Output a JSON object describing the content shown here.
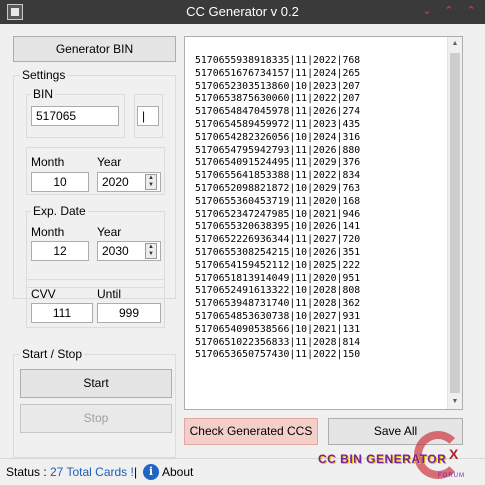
{
  "window": {
    "title": "CC Generator v 0.2",
    "controls": [
      "⌄",
      "⌃",
      "⌃"
    ]
  },
  "left": {
    "generator_bin_label": "Generator BIN",
    "settings": {
      "title": "Settings",
      "bin": {
        "label": "BIN",
        "value": "517065",
        "extra_value": "|"
      },
      "month_label": "Month",
      "year_label": "Year",
      "month_value": "10",
      "year_value": "2020"
    },
    "exp": {
      "title": "Exp. Date",
      "month_label": "Month",
      "year_label": "Year",
      "month_value": "12",
      "year_value": "2030"
    },
    "cvv": {
      "cvv_label": "CVV",
      "until_label": "Until",
      "cvv_value": "111",
      "until_value": "999"
    },
    "startstop": {
      "title": "Start / Stop",
      "start_label": "Start",
      "stop_label": "Stop"
    }
  },
  "cards": [
    "5170655938918335|11|2022|768",
    "5170651676734157|11|2024|265",
    "5170652303513860|10|2023|207",
    "5170653875630060|11|2022|207",
    "5170654847045978|11|2026|274",
    "5170654589459972|11|2023|435",
    "5170654282326056|10|2024|316",
    "5170654795942793|11|2026|880",
    "5170654091524495|11|2029|376",
    "5170655641853388|11|2022|834",
    "5170652098821872|10|2029|763",
    "5170655360453719|11|2020|168",
    "5170652347247985|10|2021|946",
    "5170655320638395|10|2026|141",
    "5170652226936344|11|2027|720",
    "5170655308254215|10|2026|351",
    "5170654159452112|10|2025|222",
    "5170651813914049|11|2020|951",
    "5170652491613322|10|2028|808",
    "5170653948731740|11|2028|362",
    "5170654853630738|10|2027|931",
    "5170654090538566|10|2021|131",
    "5170651022356833|11|2028|814",
    "5170653650757430|11|2022|150"
  ],
  "buttons": {
    "check_label": "Check Generated CCS",
    "save_label": "Save All"
  },
  "status": {
    "prefix": "Status :",
    "count_text": "27 Total Cards !",
    "separator": "|",
    "about_label": "About",
    "count_color": "#1a5fb4"
  },
  "watermark": {
    "text": "CC BIN GENERATOR",
    "x_letter": "X",
    "forum_text": "FORUM"
  }
}
